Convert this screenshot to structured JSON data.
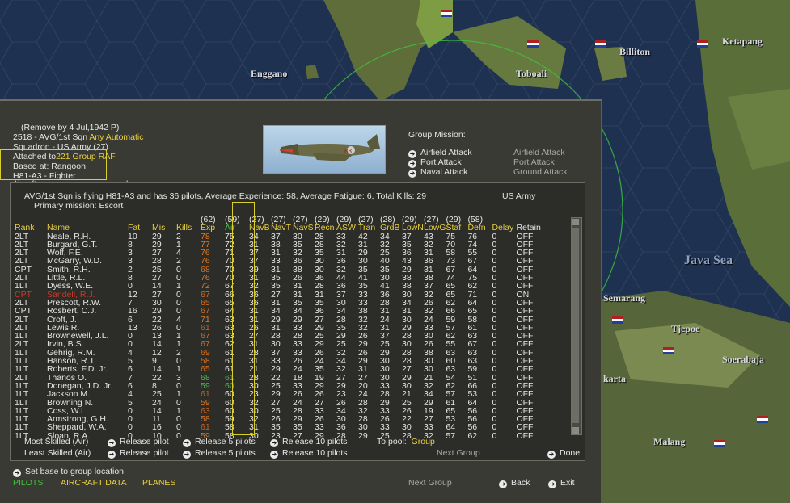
{
  "map": {
    "labels": [
      "Enggano",
      "Toboali",
      "Billiton",
      "Ketapang",
      "Java Sea",
      "Semarang",
      "Tjepoe",
      "Soerabaja",
      "karta",
      "Malang"
    ]
  },
  "header": {
    "remove_by": "(Remove by  4 Jul,1942   P)",
    "unit_id": "2518 - AVG/1st Sqn",
    "unit_flags": "Any  Automatic",
    "unit_type": "Squadron - US Army (27)",
    "attached_label": "Attached to",
    "attached_value": "221 Group RAF",
    "based_at_label": "Based at:",
    "based_at_value": "Rangoon",
    "aircraft_type": "H81-A3 - Fighter",
    "cut_left": "Aircraft",
    "cut_mid": "Losses"
  },
  "mission": {
    "title": "Group Mission:",
    "options": [
      {
        "label": "Airfield Attack",
        "alt": "Airfield Attack"
      },
      {
        "label": "Port Attack",
        "alt": "Port Attack"
      },
      {
        "label": "Naval Attack",
        "alt": "Ground Attack"
      }
    ]
  },
  "summary": {
    "line": "AVG/1st Sqn is flying H81-A3 and has 36 pilots,  Average Experience: 58,  Average Fatigue: 6,  Total Kills: 29",
    "service": "US Army",
    "primary": "Primary mission: Escort"
  },
  "table": {
    "averages": [
      "",
      "",
      "",
      "",
      "",
      "(62)",
      "(59)",
      "(27)",
      "(27)",
      "(27)",
      "(29)",
      "(29)",
      "(27)",
      "(28)",
      "(29)",
      "(27)",
      "(29)",
      "(58)",
      "",
      ""
    ],
    "columns": [
      "Rank",
      "Name",
      "Fat",
      "Mis",
      "Kills",
      "Exp",
      "Air",
      "NavB",
      "NavT",
      "NavS",
      "Recn",
      "ASW",
      "Tran",
      "GrdB",
      "LowN",
      "LowG",
      "Staf",
      "Defn",
      "Delay",
      "Retain"
    ],
    "rows": [
      [
        "2LT",
        "Neale, R.H.",
        "10",
        "29",
        "2",
        "78",
        "75",
        "34",
        "37",
        "30",
        "28",
        "33",
        "42",
        "34",
        "37",
        "43",
        "75",
        "76",
        "0",
        "OFF"
      ],
      [
        "2LT",
        "Burgard, G.T.",
        "8",
        "29",
        "1",
        "77",
        "72",
        "31",
        "38",
        "35",
        "28",
        "32",
        "31",
        "32",
        "35",
        "32",
        "70",
        "74",
        "0",
        "OFF"
      ],
      [
        "2LT",
        "Wolf, F.E.",
        "3",
        "27",
        "4",
        "76",
        "71",
        "37",
        "31",
        "32",
        "35",
        "31",
        "29",
        "25",
        "36",
        "31",
        "58",
        "55",
        "0",
        "OFF"
      ],
      [
        "2LT",
        "McGarry, W.D.",
        "3",
        "28",
        "2",
        "76",
        "70",
        "37",
        "33",
        "36",
        "30",
        "36",
        "30",
        "40",
        "43",
        "36",
        "73",
        "67",
        "0",
        "OFF"
      ],
      [
        "CPT",
        "Smith, R.H.",
        "2",
        "25",
        "0",
        "68",
        "70",
        "39",
        "31",
        "38",
        "30",
        "32",
        "35",
        "35",
        "29",
        "31",
        "67",
        "64",
        "0",
        "OFF"
      ],
      [
        "2LT",
        "Little, R.L.",
        "8",
        "27",
        "0",
        "76",
        "70",
        "31",
        "35",
        "26",
        "36",
        "44",
        "41",
        "30",
        "38",
        "38",
        "74",
        "75",
        "0",
        "OFF"
      ],
      [
        "1LT",
        "Dyess, W.E.",
        "0",
        "14",
        "1",
        "72",
        "67",
        "32",
        "35",
        "31",
        "28",
        "36",
        "35",
        "41",
        "38",
        "37",
        "65",
        "62",
        "0",
        "OFF"
      ],
      [
        "CPT",
        "Sandell, R.J.",
        "12",
        "27",
        "0",
        "67",
        "66",
        "36",
        "27",
        "31",
        "31",
        "37",
        "33",
        "36",
        "30",
        "32",
        "65",
        "71",
        "0",
        "ON"
      ],
      [
        "2LT",
        "Prescott, R.W.",
        "7",
        "30",
        "0",
        "65",
        "65",
        "36",
        "31",
        "35",
        "35",
        "30",
        "33",
        "28",
        "34",
        "26",
        "62",
        "64",
        "0",
        "OFF"
      ],
      [
        "CPT",
        "Rosbert, C.J.",
        "16",
        "29",
        "0",
        "67",
        "64",
        "31",
        "34",
        "34",
        "36",
        "34",
        "38",
        "31",
        "31",
        "32",
        "66",
        "65",
        "0",
        "OFF"
      ],
      [
        "2LT",
        "Croft, J.",
        "6",
        "22",
        "4",
        "71",
        "63",
        "31",
        "29",
        "29",
        "27",
        "28",
        "32",
        "24",
        "30",
        "24",
        "59",
        "58",
        "0",
        "OFF"
      ],
      [
        "2LT",
        "Lewis R.",
        "13",
        "26",
        "0",
        "61",
        "63",
        "26",
        "31",
        "33",
        "29",
        "35",
        "32",
        "31",
        "29",
        "33",
        "57",
        "61",
        "0",
        "OFF"
      ],
      [
        "1LT",
        "Brownewell, J.L.",
        "0",
        "13",
        "1",
        "67",
        "63",
        "27",
        "28",
        "28",
        "25",
        "29",
        "26",
        "37",
        "28",
        "30",
        "62",
        "63",
        "0",
        "OFF"
      ],
      [
        "2LT",
        "Irvin, B.S.",
        "0",
        "14",
        "1",
        "67",
        "62",
        "31",
        "30",
        "33",
        "29",
        "25",
        "29",
        "25",
        "30",
        "26",
        "55",
        "67",
        "0",
        "OFF"
      ],
      [
        "1LT",
        "Gehrig, R.M.",
        "4",
        "12",
        "2",
        "69",
        "61",
        "28",
        "37",
        "33",
        "26",
        "32",
        "26",
        "29",
        "28",
        "38",
        "63",
        "63",
        "0",
        "OFF"
      ],
      [
        "1LT",
        "Hanson, R.T.",
        "5",
        "9",
        "0",
        "58",
        "61",
        "31",
        "33",
        "26",
        "24",
        "34",
        "29",
        "30",
        "28",
        "30",
        "60",
        "63",
        "0",
        "OFF"
      ],
      [
        "1LT",
        "Roberts, F.D. Jr.",
        "6",
        "14",
        "1",
        "65",
        "61",
        "21",
        "29",
        "24",
        "35",
        "32",
        "31",
        "30",
        "27",
        "30",
        "63",
        "59",
        "0",
        "OFF"
      ],
      [
        "2LT",
        "Thanos O.",
        "7",
        "22",
        "3",
        "68",
        "61",
        "28",
        "22",
        "18",
        "19",
        "27",
        "27",
        "30",
        "29",
        "21",
        "54",
        "51",
        "0",
        "OFF"
      ],
      [
        "1LT",
        "Donegan, J.D. Jr.",
        "6",
        "8",
        "0",
        "59",
        "60",
        "30",
        "25",
        "33",
        "29",
        "29",
        "20",
        "33",
        "30",
        "32",
        "62",
        "66",
        "0",
        "OFF"
      ],
      [
        "1LT",
        "Jackson M.",
        "4",
        "25",
        "1",
        "61",
        "60",
        "23",
        "29",
        "26",
        "26",
        "23",
        "24",
        "28",
        "21",
        "34",
        "57",
        "53",
        "0",
        "OFF"
      ],
      [
        "1LT",
        "Browning N.",
        "5",
        "24",
        "0",
        "59",
        "60",
        "32",
        "27",
        "24",
        "27",
        "26",
        "28",
        "29",
        "25",
        "29",
        "61",
        "64",
        "0",
        "OFF"
      ],
      [
        "1LT",
        "Coss, W.L.",
        "0",
        "14",
        "1",
        "63",
        "60",
        "30",
        "25",
        "28",
        "33",
        "34",
        "32",
        "33",
        "26",
        "19",
        "65",
        "56",
        "0",
        "OFF"
      ],
      [
        "1LT",
        "Armstrong, G.H.",
        "0",
        "11",
        "0",
        "58",
        "59",
        "32",
        "26",
        "29",
        "26",
        "30",
        "28",
        "26",
        "22",
        "27",
        "53",
        "56",
        "0",
        "OFF"
      ],
      [
        "1LT",
        "Sheppard, W.A.",
        "0",
        "16",
        "0",
        "61",
        "58",
        "31",
        "35",
        "35",
        "33",
        "36",
        "30",
        "33",
        "30",
        "33",
        "64",
        "56",
        "0",
        "OFF"
      ],
      [
        "1LT",
        "Sloan, R.A.",
        "0",
        "10",
        "0",
        "59",
        "58",
        "30",
        "23",
        "27",
        "29",
        "28",
        "29",
        "25",
        "28",
        "32",
        "57",
        "62",
        "0",
        "OFF"
      ]
    ]
  },
  "footer": {
    "most_skilled": "Most Skilled (Air)",
    "least_skilled": "Least Skilled (Air)",
    "release_pilot": "Release pilot",
    "release_5": "Release 5 pilots",
    "release_10": "Release 10 pilots",
    "to_pool_label": "To pool:",
    "to_pool_value": "Group",
    "next_group_inner": "Next Group",
    "done": "Done",
    "set_base": "Set base to group location",
    "tab_pilots": "PILOTS",
    "tab_aircraft": "AIRCRAFT DATA",
    "tab_planes": "PLANES",
    "next_group": "Next Group",
    "back": "Back",
    "exit": "Exit"
  },
  "colors": {
    "panel": "#3a3a34",
    "yellow": "#e8d040",
    "green": "#3ec43e",
    "orange": "#d86e1e",
    "red": "#c83a2a"
  }
}
